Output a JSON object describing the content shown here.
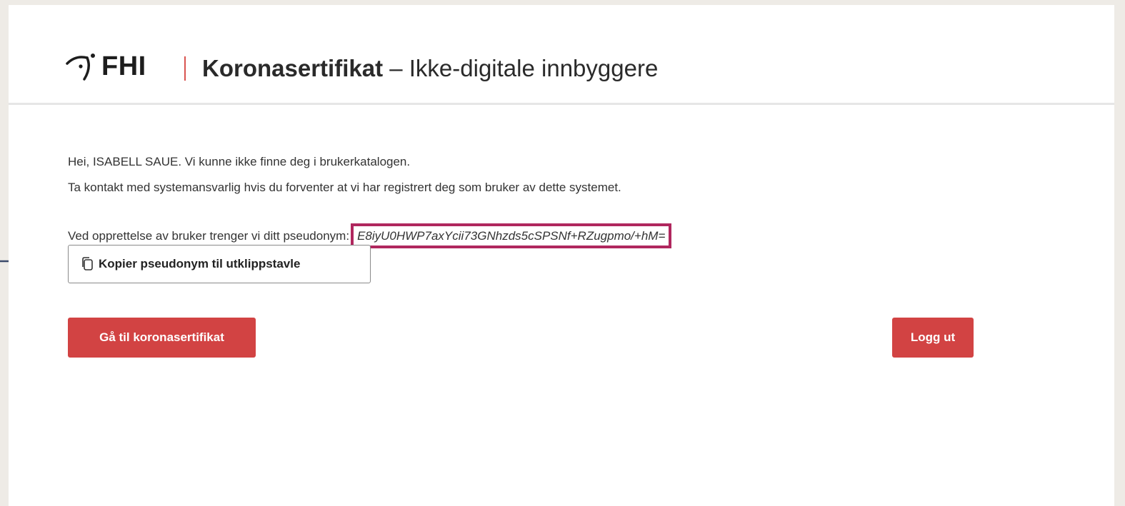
{
  "header": {
    "logo_text": "FHI",
    "title_bold": "Koronasertifikat",
    "title_rest": " – Ikke-digitale innbyggere"
  },
  "main": {
    "greeting": "Hei, ISABELL SAUE. Vi kunne ikke finne deg i brukerkatalogen.",
    "contact": "Ta kontakt med systemansvarlig hvis du forventer at vi har registrert deg som bruker av dette systemet.",
    "pseudonym_label": "Ved opprettelse av bruker trenger vi ditt pseudonym:",
    "pseudonym_value": "E8iyU0HWP7axYcii73GNhzds5cSPSNf+RZugpmo/+hM=",
    "copy_button": "Kopier pseudonym til utklippstavle",
    "go_button": "Gå til koronasertifikat",
    "logout_button": "Logg ut"
  },
  "colors": {
    "accent_red": "#d24343",
    "highlight_border": "#b0275e",
    "arrow": "#3b4a6b"
  }
}
